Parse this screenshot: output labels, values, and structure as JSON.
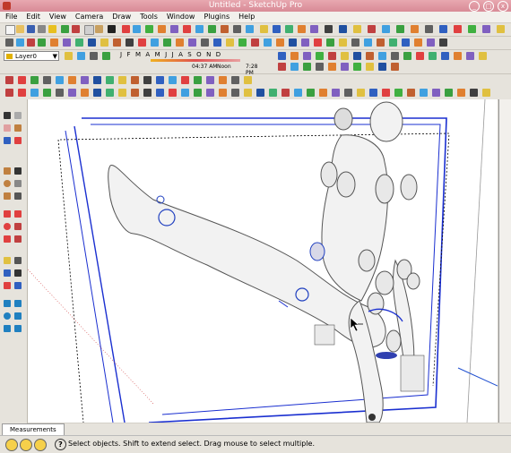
{
  "window": {
    "title": "Untitled - SketchUp Pro"
  },
  "menu": [
    "File",
    "Edit",
    "View",
    "Camera",
    "Draw",
    "Tools",
    "Window",
    "Plugins",
    "Help"
  ],
  "layer": {
    "name": "Layer0"
  },
  "shadow": {
    "months": "J F M A M J J A S O N D",
    "time_start": "04:37 AM",
    "time_mid": "Noon",
    "time_end": "7:28 PM"
  },
  "measurements_label": "Measurements",
  "status": {
    "message": "Select objects. Shift to extend select. Drag mouse to select multiple.",
    "help": "?"
  },
  "colors": {
    "title_bar": "#d88a96",
    "toolbar_bg": "#e6e3dc",
    "viewport_bg": "#ffffff",
    "section_blue": "#1a2fd0"
  }
}
